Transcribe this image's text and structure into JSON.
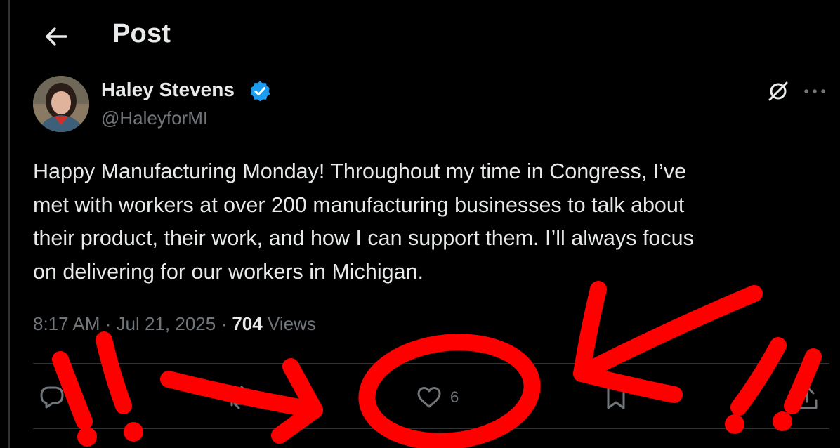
{
  "header": {
    "title": "Post"
  },
  "author": {
    "display_name": "Haley Stevens",
    "handle": "@HaleyforMI",
    "verified": true
  },
  "post": {
    "text": "Happy Manufacturing Monday! Throughout my time in Congress, I’ve\nmet with workers at over 200 manufacturing businesses to talk about\ntheir product, their work, and how I can support them. I’ll always focus\non delivering for our workers in Michigan.",
    "time": "8:17 AM",
    "date": "Jul 21, 2025",
    "views_count": "704",
    "views_label": "Views"
  },
  "actions": {
    "likes_count": "6"
  },
  "colors": {
    "background": "#000000",
    "text": "#e7e9ea",
    "muted": "#71767b",
    "verified": "#1d9bf0",
    "annotation": "#ff0000"
  },
  "icons": [
    "back-arrow-icon",
    "verified-badge-icon",
    "grok-icon",
    "more-icon",
    "reply-icon",
    "repost-icon",
    "heart-icon",
    "bookmark-icon",
    "share-icon"
  ]
}
